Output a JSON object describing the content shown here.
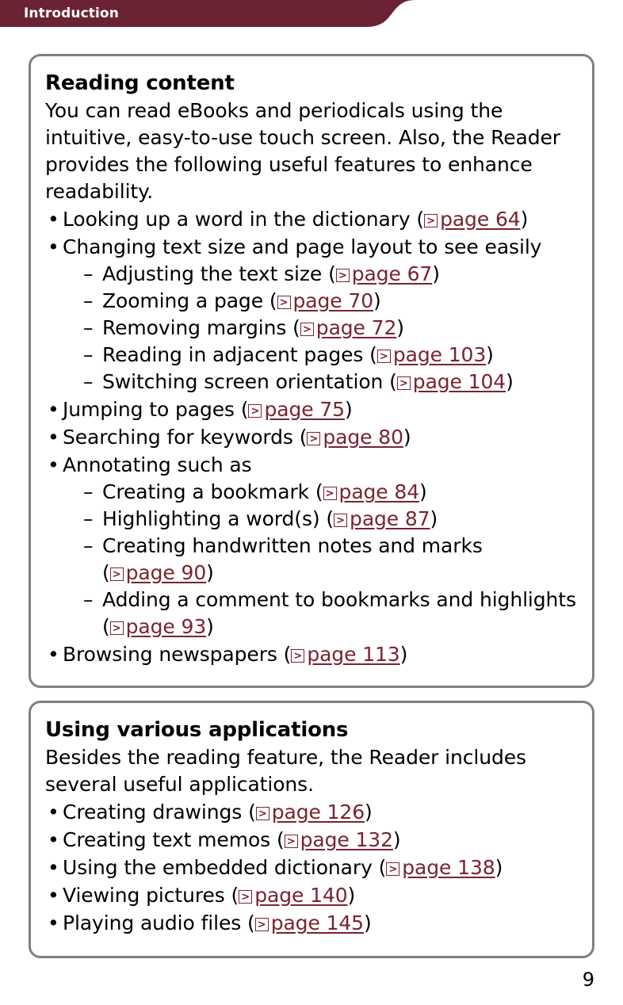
{
  "header": {
    "title": "Introduction",
    "bar_color": "#6B2333",
    "title_color": "#FFFFFF"
  },
  "theme": {
    "link_color": "#7A2331",
    "panel_border_color": "#808080",
    "text_color": "#000000",
    "page_background": "#FFFFFF"
  },
  "ref_icon_name": "page-reference-icon",
  "panels": [
    {
      "id": "reading-content",
      "title": "Reading content",
      "intro": "You can read eBooks and periodicals using the intuitive, easy-to-use touch screen. Also, the Reader provides the following useful features to enhance readability.",
      "items": [
        {
          "text": "Looking up a word in the dictionary",
          "ref": "page 64",
          "ref_inline": true,
          "subitems": []
        },
        {
          "text": "Changing text size and page layout to see easily",
          "ref": null,
          "subitems": [
            {
              "text": "Adjusting the text size",
              "ref": "page 67",
              "ref_inline": true
            },
            {
              "text": "Zooming a page",
              "ref": "page 70",
              "ref_inline": true
            },
            {
              "text": "Removing margins",
              "ref": "page 72",
              "ref_inline": true
            },
            {
              "text": "Reading in adjacent pages",
              "ref": "page 103",
              "ref_inline": true
            },
            {
              "text": "Switching screen orientation",
              "ref": "page 104",
              "ref_inline": true
            }
          ]
        },
        {
          "text": "Jumping to pages",
          "ref": "page 75",
          "ref_inline": true,
          "subitems": []
        },
        {
          "text": "Searching for keywords",
          "ref": "page 80",
          "ref_inline": true,
          "subitems": []
        },
        {
          "text": "Annotating such as",
          "ref": null,
          "subitems": [
            {
              "text": "Creating a bookmark",
              "ref": "page 84",
              "ref_inline": true
            },
            {
              "text": "Highlighting a word(s)",
              "ref": "page 87",
              "ref_inline": true
            },
            {
              "text": "Creating handwritten notes and marks",
              "ref": "page 90",
              "ref_inline": false
            },
            {
              "text": "Adding a comment to bookmarks and highlights",
              "ref": "page 93",
              "ref_inline": false
            }
          ]
        },
        {
          "text": "Browsing newspapers",
          "ref": "page 113",
          "ref_inline": true,
          "subitems": []
        }
      ]
    },
    {
      "id": "using-various-applications",
      "title": "Using various applications",
      "intro": "Besides the reading feature, the Reader includes several useful applications.",
      "items": [
        {
          "text": "Creating drawings",
          "ref": "page 126",
          "ref_inline": true,
          "subitems": []
        },
        {
          "text": "Creating text memos",
          "ref": "page 132",
          "ref_inline": true,
          "subitems": []
        },
        {
          "text": "Using the embedded dictionary",
          "ref": "page 138",
          "ref_inline": true,
          "subitems": []
        },
        {
          "text": "Viewing pictures",
          "ref": "page 140",
          "ref_inline": true,
          "subitems": []
        },
        {
          "text": "Playing audio files",
          "ref": "page 145",
          "ref_inline": true,
          "subitems": []
        }
      ]
    }
  ],
  "bullet_glyph": "•",
  "dash_glyph": "–",
  "folio": "9"
}
